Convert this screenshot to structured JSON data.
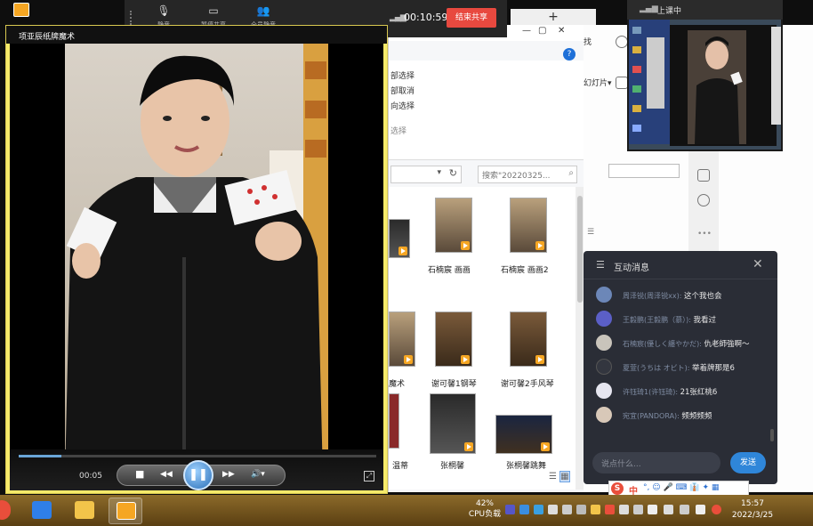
{
  "toolbar": {
    "buttons": [
      {
        "icon": "microphone-icon",
        "glyph": "🎙",
        "label": "静音"
      },
      {
        "icon": "screen-share-icon",
        "glyph": "▭",
        "label": "暂停共享"
      },
      {
        "icon": "mute-all-icon",
        "glyph": "👥",
        "label": "全员静音"
      }
    ],
    "timer": "00:10:59",
    "end_share_label": "结束共享",
    "new_tab": "+"
  },
  "camera_preview": {
    "status_label": "上课中"
  },
  "player": {
    "title": "项亚辰纸牌魔术",
    "elapsed": "00:05",
    "progress_fraction": 0.12,
    "buttons": {
      "stop": "■",
      "prev": "◀◀",
      "pause": "❚❚",
      "next": "▶▶",
      "volume": "🔊▾",
      "fullscreen": "⤢"
    }
  },
  "explorer": {
    "ribbon": [
      "部选择",
      "部取消",
      "向选择",
      "选择"
    ],
    "search_placeholder": "搜索\"20220325...",
    "files": [
      {
        "name": "石楠宸  画画"
      },
      {
        "name": "石楠宸  画画2"
      },
      {
        "name": "魔术"
      },
      {
        "name": "谢可馨1钢琴"
      },
      {
        "name": "谢可馨2手风琴"
      },
      {
        "name": "温蒂"
      },
      {
        "name": "张桐馨"
      },
      {
        "name": "张桐馨跳舞"
      }
    ]
  },
  "right_app": {
    "labels": [
      "找",
      "幻灯片▾"
    ]
  },
  "chat": {
    "title": "互动消息",
    "messages": [
      {
        "name": "周泽锐(周泽锐xx):",
        "text": "这个我也会"
      },
      {
        "name": "王毅鹏(王毅鹏（慕）):",
        "text": "我看过"
      },
      {
        "name": "石楠宸(優しく纏やかだ):",
        "text": "仇老師強啊～"
      },
      {
        "name": "夏萱(うちは オビト):",
        "text": "举着牌那是6"
      },
      {
        "name": "许钰琦1(许钰琦):",
        "text": "21张红桃6"
      },
      {
        "name": "宛宜(PANDORA):",
        "text": "频频频频"
      }
    ],
    "input_placeholder": "说点什么...",
    "send_label": "发送"
  },
  "ime": {
    "lang": "中",
    "extra": "°, ☺ 🎤 ⌨ 👔 ✦ ▦"
  },
  "taskbar": {
    "cpu_percent": "42%",
    "cpu_label": "CPU负载",
    "time": "15:57",
    "date": "2022/3/25"
  }
}
